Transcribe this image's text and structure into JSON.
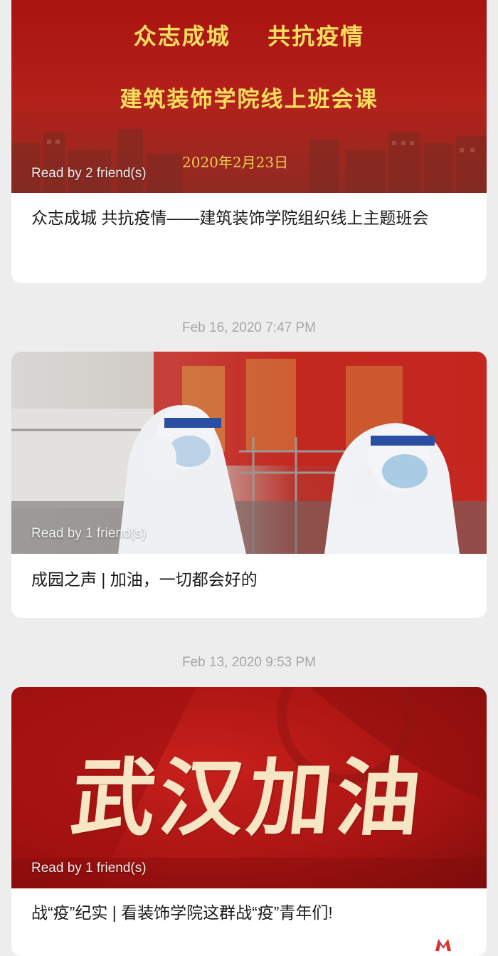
{
  "feed": {
    "articles": [
      {
        "cover_line1": "众志成城    共抗疫情",
        "cover_line2": "建筑装饰学院线上班会课",
        "cover_date": "2020年2月23日",
        "read_by": "Read by 2 friend(s)",
        "title": "众志成城 共抗疫情——建筑装饰学院组织线上主题班会"
      },
      {
        "timestamp": "Feb 16, 2020 7:47 PM",
        "read_by": "Read by 1 friend(s)",
        "title": "成园之声 | 加油，一切都会好的"
      },
      {
        "timestamp": "Feb 13, 2020 9:53 PM",
        "cover_slogan": "武汉加油",
        "read_by": "Read by 1 friend(s)",
        "title": "战“疫”纪实 | 看装饰学院这群战“疫”青年们!"
      }
    ]
  },
  "colors": {
    "background": "#ededed",
    "card": "#ffffff",
    "cover_red": "#b3211b",
    "cover_gold": "#f8df5e",
    "timestamp_gray": "#a6a6a6"
  }
}
